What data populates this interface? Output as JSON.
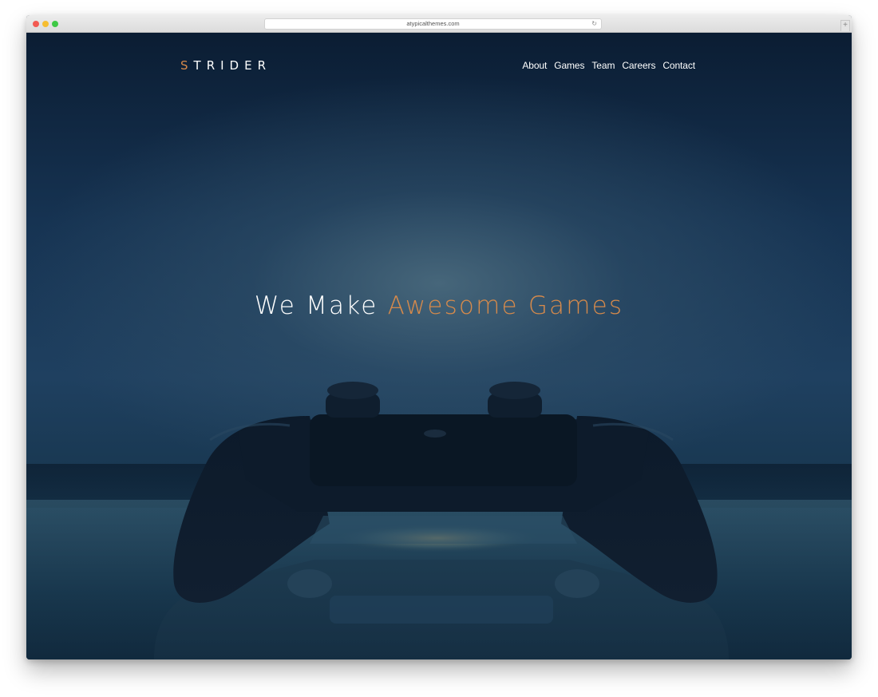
{
  "browser": {
    "url": "atypicalthemes.com"
  },
  "brand": {
    "logo_first": "S",
    "logo_rest": "TRIDER",
    "accent_color": "#d68a4b"
  },
  "nav": {
    "items": [
      {
        "label": "About"
      },
      {
        "label": "Games"
      },
      {
        "label": "Team"
      },
      {
        "label": "Careers"
      },
      {
        "label": "Contact"
      }
    ]
  },
  "hero": {
    "headline_plain": "We Make ",
    "headline_accent": "Awesome Games",
    "background_color": "#163352"
  },
  "icons": {
    "reload": "reload-icon",
    "new_tab": "plus-icon"
  }
}
